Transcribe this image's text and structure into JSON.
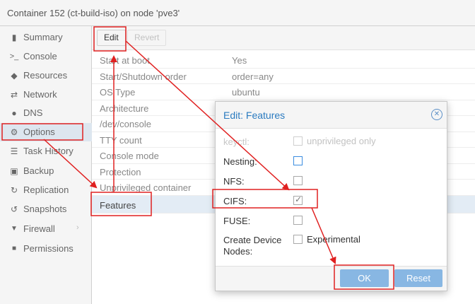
{
  "window": {
    "title": "Container 152 (ct-build-iso) on node 'pve3'"
  },
  "sidebar": {
    "items": [
      {
        "label": "Summary",
        "icon": "book-icon",
        "glyph": "▮"
      },
      {
        "label": "Console",
        "icon": "terminal-icon",
        "glyph": ">_"
      },
      {
        "label": "Resources",
        "icon": "cube-icon",
        "glyph": "◆"
      },
      {
        "label": "Network",
        "icon": "exchange-icon",
        "glyph": "⇄"
      },
      {
        "label": "DNS",
        "icon": "globe-icon",
        "glyph": "●"
      },
      {
        "label": "Options",
        "icon": "gear-icon",
        "glyph": "⚙"
      },
      {
        "label": "Task History",
        "icon": "list-icon",
        "glyph": "☰"
      },
      {
        "label": "Backup",
        "icon": "floppy-icon",
        "glyph": "▣"
      },
      {
        "label": "Replication",
        "icon": "retweet-icon",
        "glyph": "↻"
      },
      {
        "label": "Snapshots",
        "icon": "history-icon",
        "glyph": "↺"
      },
      {
        "label": "Firewall",
        "icon": "shield-icon",
        "glyph": "▼"
      },
      {
        "label": "Permissions",
        "icon": "unlock-icon",
        "glyph": "■"
      }
    ],
    "active": "Options"
  },
  "toolbar": {
    "edit_label": "Edit",
    "revert_label": "Revert"
  },
  "options": {
    "rows": [
      {
        "key": "Start at boot",
        "value": "Yes"
      },
      {
        "key": "Start/Shutdown order",
        "value": "order=any"
      },
      {
        "key": "OS Type",
        "value": "ubuntu"
      },
      {
        "key": "Architecture",
        "value": ""
      },
      {
        "key": "/dev/console",
        "value": ""
      },
      {
        "key": "TTY count",
        "value": ""
      },
      {
        "key": "Console mode",
        "value": ""
      },
      {
        "key": "Protection",
        "value": ""
      },
      {
        "key": "Unprivileged container",
        "value": ""
      },
      {
        "key": "Features",
        "value": ""
      }
    ]
  },
  "dialog": {
    "title": "Edit: Features",
    "fields": {
      "keyctl": {
        "label": "keyctl:",
        "checkbox_label": "unprivileged only"
      },
      "nesting": {
        "label": "Nesting:"
      },
      "nfs": {
        "label": "NFS:"
      },
      "cifs": {
        "label": "CIFS:"
      },
      "fuse": {
        "label": "FUSE:"
      },
      "mknod": {
        "label_line1": "Create Device",
        "label_line2": "Nodes:",
        "checkbox_label": "Experimental"
      }
    },
    "ok_label": "OK",
    "reset_label": "Reset"
  },
  "annotation_color": "#e02020"
}
